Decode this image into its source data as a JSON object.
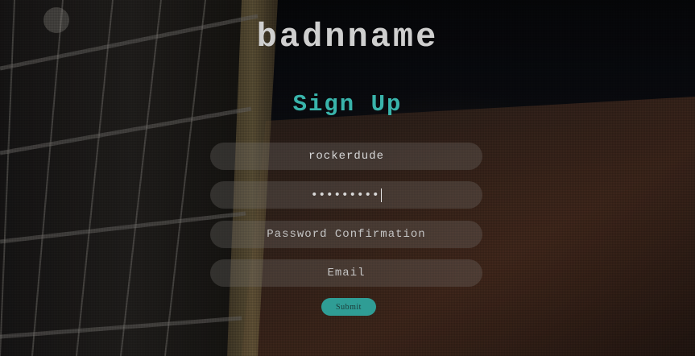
{
  "brand": {
    "name": "badnname"
  },
  "form": {
    "title": "Sign Up",
    "username": {
      "value": "rockerdude"
    },
    "password": {
      "masked_value": "•••••••••"
    },
    "password_confirmation": {
      "placeholder": "Password Confirmation"
    },
    "email": {
      "placeholder": "Email"
    },
    "submit_label": "Submit"
  },
  "colors": {
    "accent": "#39b4ab",
    "button": "#2f9d95",
    "field": "#78736f"
  }
}
